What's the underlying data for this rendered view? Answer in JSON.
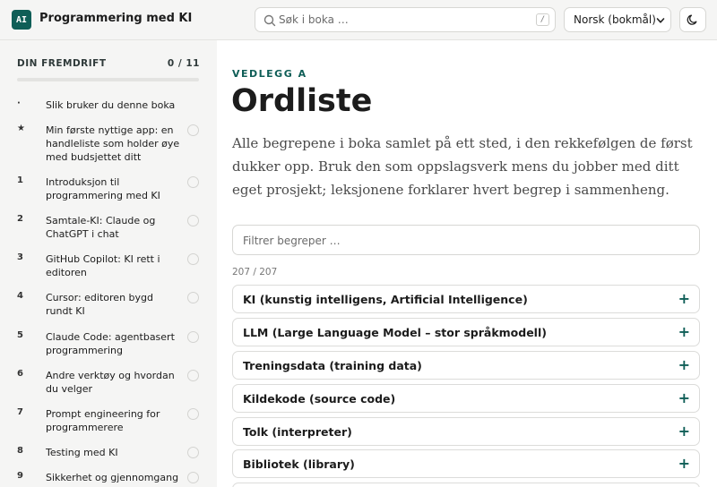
{
  "header": {
    "logo_text": "AI",
    "title": "Programmering med KI",
    "search_placeholder": "Søk i boka …",
    "search_shortcut": "/",
    "language": "Norsk (bokmål)",
    "theme_icon": "moon-icon"
  },
  "sidebar": {
    "progress_label": "DIN FREMDRIFT",
    "progress_count": "0 / 11",
    "progress_value": 0,
    "items": [
      {
        "num": "·",
        "label": "Slik bruker du denne boka",
        "check": false
      },
      {
        "num": "★",
        "label": "Min første nyttige app: en handleliste som holder øye med budsjettet ditt",
        "check": true
      },
      {
        "num": "1",
        "label": "Introduksjon til programmering med KI",
        "check": true
      },
      {
        "num": "2",
        "label": "Samtale-KI: Claude og ChatGPT i chat",
        "check": true
      },
      {
        "num": "3",
        "label": "GitHub Copilot: KI rett i editoren",
        "check": true
      },
      {
        "num": "4",
        "label": "Cursor: editoren bygd rundt KI",
        "check": true
      },
      {
        "num": "5",
        "label": "Claude Code: agentbasert programmering",
        "check": true
      },
      {
        "num": "6",
        "label": "Andre verktøy og hvordan du velger",
        "check": true
      },
      {
        "num": "7",
        "label": "Prompt engineering for programmerere",
        "check": true
      },
      {
        "num": "8",
        "label": "Testing med KI",
        "check": true
      },
      {
        "num": "9",
        "label": "Sikkerhet og gjennomgang",
        "check": true
      }
    ]
  },
  "main": {
    "eyebrow": "VEDLEGG A",
    "title": "Ordliste",
    "intro": "Alle begrepene i boka samlet på ett sted, i den rekkefølgen de først dukker opp. Bruk den som oppslagsverk mens du jobber med ditt eget prosjekt; leksjonene forklarer hvert begrep i sammenheng.",
    "filter_placeholder": "Filtrer begreper …",
    "count": "207 / 207",
    "expand_symbol": "+",
    "terms": [
      "KI (kunstig intelligens, Artificial Intelligence)",
      "LLM (Large Language Model – stor språkmodell)",
      "Treningsdata (training data)",
      "Kildekode (source code)",
      "Tolk (interpreter)",
      "Bibliotek (library)"
    ]
  },
  "colors": {
    "accent": "#0f5e57",
    "sidebar_bg": "#f5f5f4",
    "border": "#dcdcda"
  }
}
